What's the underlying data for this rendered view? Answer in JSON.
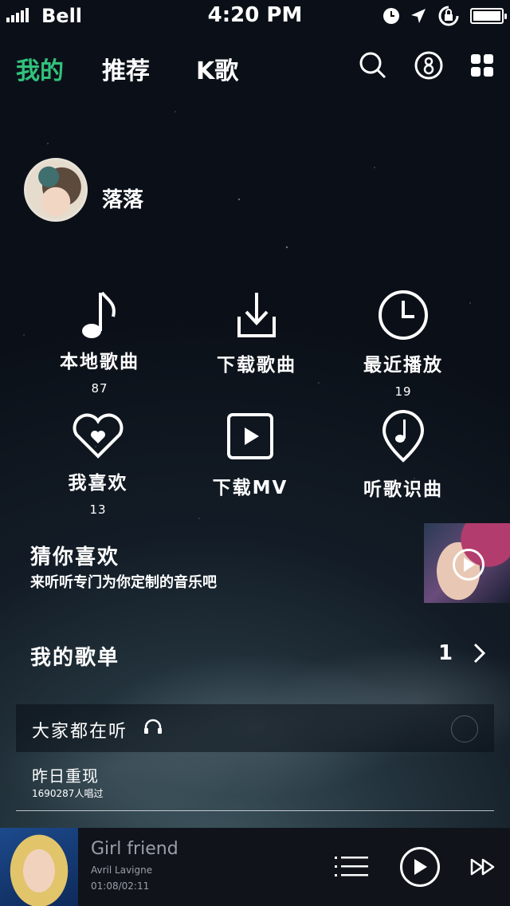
{
  "status_bar": {
    "carrier": "Bell",
    "time": "4:20 PM"
  },
  "nav": {
    "tabs": [
      {
        "label": "我的",
        "active": true
      },
      {
        "label": "推荐",
        "active": false
      },
      {
        "label": "K歌",
        "active": false
      }
    ],
    "icons": [
      "search-icon",
      "profile-icon",
      "grid-menu-icon"
    ]
  },
  "profile": {
    "username": "落落"
  },
  "grid": [
    {
      "label": "本地歌曲",
      "count": "87",
      "icon": "music-note-icon"
    },
    {
      "label": "下载歌曲",
      "count": "",
      "icon": "download-icon"
    },
    {
      "label": "最近播放",
      "count": "19",
      "icon": "clock-icon"
    },
    {
      "label": "我喜欢",
      "count": "13",
      "icon": "heart-icon"
    },
    {
      "label": "下载MV",
      "count": "",
      "icon": "mv-play-icon"
    },
    {
      "label": "听歌识曲",
      "count": "",
      "icon": "music-pin-icon"
    }
  ],
  "guess": {
    "title": "猜你喜欢",
    "subtitle": "来听听专门为你定制的音乐吧"
  },
  "playlist": {
    "title": "我的歌单",
    "count": "1"
  },
  "everyone": {
    "label": "大家都在听",
    "song": "昨日重现",
    "listeners": "1690287人唱过"
  },
  "player": {
    "title": "Girl friend",
    "artist": "Avril Lavigne",
    "time": "01:08/02:11",
    "progress": 0.52
  },
  "colors": {
    "accent": "#31c27c",
    "player_bg": "#10141a"
  }
}
